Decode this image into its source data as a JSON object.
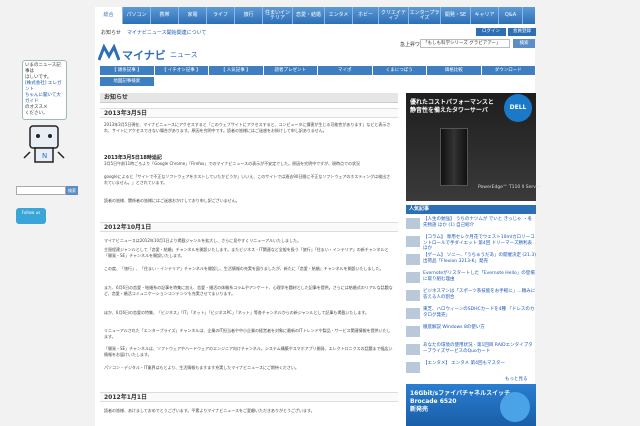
{
  "left_widget": {
    "bubble_lines": [
      "いまのニュース記事は",
      "ほしいです。",
      "[株式会社] エレガント",
      "ちゃんに聞いて大ガイド",
      "のオススメ",
      "ください。"
    ],
    "search_button": "検索",
    "twitter_badge": "Follow us"
  },
  "top_nav": {
    "items": [
      "総合",
      "パソコン",
      "携帯",
      "家電",
      "ライフ",
      "旅行",
      "住まいインテリア",
      "恋愛・結婚",
      "エンタメ",
      "ホビー",
      "クリエイティブ",
      "エンタープライズ",
      "開発・SE",
      "キャリア",
      "Q&A"
    ],
    "active_index": 0
  },
  "header": {
    "news_label": "お知らせ",
    "news_link": "マイナビニュース開始関連について",
    "login": "ログイン",
    "register": "会員登録",
    "logo_text": "マイナビ",
    "logo_sub": "ニュース",
    "search_label": "急上昇ワード",
    "search_value": "「もしも科学シリーズ グラビアアー」",
    "search_button": "検索"
  },
  "categories": [
    "【 頭条記事 】",
    "【 イチオシ記事 】",
    "【 人気記事 】",
    "読者プレゼント",
    "マイポ",
    "くまにつぼう",
    "価格比較",
    "ダウンロード",
    "地図記事検索"
  ],
  "content": {
    "title": "お知らせ",
    "sections": [
      {
        "heading": "2013年3月5日",
        "paragraphs": [
          "2013年3月5日現在、マイナビニュースにアクセスすると「このウェブサイトにアクセスすると、コンピュータに損害が生じる可能性があります」などと表示され、サイトにアクセスできない場合があります。原因を究明中です。読者の皆様にはご迷惑をお掛けして申し訳ありません。"
        ]
      },
      {
        "subheading": "2013年3月5日18時追記",
        "paragraphs": [
          "3月5日午前11時ごろより「Google Chrome」「Firefox」でのマイナビニュースの表示が不安定でした。原因を究明中ですが、現時点での状況",
          "googleによると「サイトで不正なソフトウェアをホストしていたかどうか」いいえ、このサイトでは過去90日間に不正なソフトウェアのホスティングは検出されていません。」とされています。",
          "読者の皆様、関係者の皆様にはご迷惑おかけしており申し訳ございません。"
        ]
      },
      {
        "heading": "2012年10月1日",
        "paragraphs": [
          "マイナビニュースは2012年10月1日より掲載ジャンルを拡大し、さらに見やすくリニューアルいたしました。",
          "主過程建ジャンルとして「恋愛・結婚」チャンネルを開設いたします。またビジネス・IT関連など全般を扱う「旅行」「住まい・インテリア」の新チャンネルと「開発・SE」チャンネルを開設いたします。",
          "この度、「旅行」、「住まい・インテリア」チャンネルを開設し、生活情報の充実を図りましたが、新たに「恋愛・結婚」チャンネルを開設いたしました。",
          "また、6月6日の恋愛・結婚系の記事を特集に加え、恋愛・婚活の体験系コラムやアンケート、心理学を題材とした記事を提供。さらには結婚式のリアルな話題など、恋愛・婚活コミュニケーションコンテンツも充実させてまいります。",
          "ほか、6月6日の恋愛の特集、「ビジネス」「IT」「ネット」「ビジネスPC」「ネット」等各チャンネルからの新ジャンルとして記事も掲載いたします。",
          "リニューアルされた「エンタープライズ」チャンネルは、企業のIT担当者や中小企業の経営者を対象に最新のITトレンドや製品・サービス関連情報を提供いたします。",
          "「開発・SE」チャンネルは、ソフトウェアやハードウェアのエンジニア向けチャンネル。システム構築やスマホアプリ開発、エレクトロニクスの話題まで幅広い情報をお届けいたします。",
          "パソコン・デジタル・IT業界はもとより、生活情報もますます充実したマイナビニュースにご期待ください。"
        ]
      },
      {
        "heading": "2012年1月1日",
        "paragraphs": [
          "読者の皆様、あけましておめでとうございます。平素よりマイナビニュースをご愛顧いただきありがとうございます。"
        ]
      }
    ]
  },
  "right": {
    "ad_top_lines": [
      "優れたコストパフォーマンスと",
      "静音性を備えたタワーサーバ"
    ],
    "dell": "DELL",
    "ad_top_caption": "PowerEdge™ T110 II Server",
    "ranking_head": "人気記事",
    "ranking": [
      "【人生の勉強】 うちのナツムが でいと きっじゃ ・冬先物語 ほか (1) 自己紹介",
      "【コラム】 専用セレク月花でウェスト10mlカロリーコントロールで手ダイエット 第4回 ドリーマーズ勝利表 ほか",
      "【ゲーム】 ソニー、「うちゅうだあ」の開催決定 (21.3) 出荷品「Flexion 3213-K」発売",
      "Evernoteがリスタートした「Evernote Hello」の登場に取り組む理由",
      "ビジネスマンは「スポーツ系技能をお手軽に」…頼みに答える人の割合",
      "東芝、ハロウィーンのSDHCカードを4種 「ドレスのカタログ発売」",
      "徹底解説 Windows 8の使い方",
      "あなたの環境の使用状況 - 第1回目 RAIDエンタイプタープライズサービスのQuoカード",
      "【エンタメ】 エンタメ 第4回もマスター"
    ],
    "ranking_more": "もっと見る",
    "ad_bottom_lines": [
      "16Gbit/sファイバチャネルスイッチ",
      "Brocade 6520",
      "新発売"
    ]
  }
}
